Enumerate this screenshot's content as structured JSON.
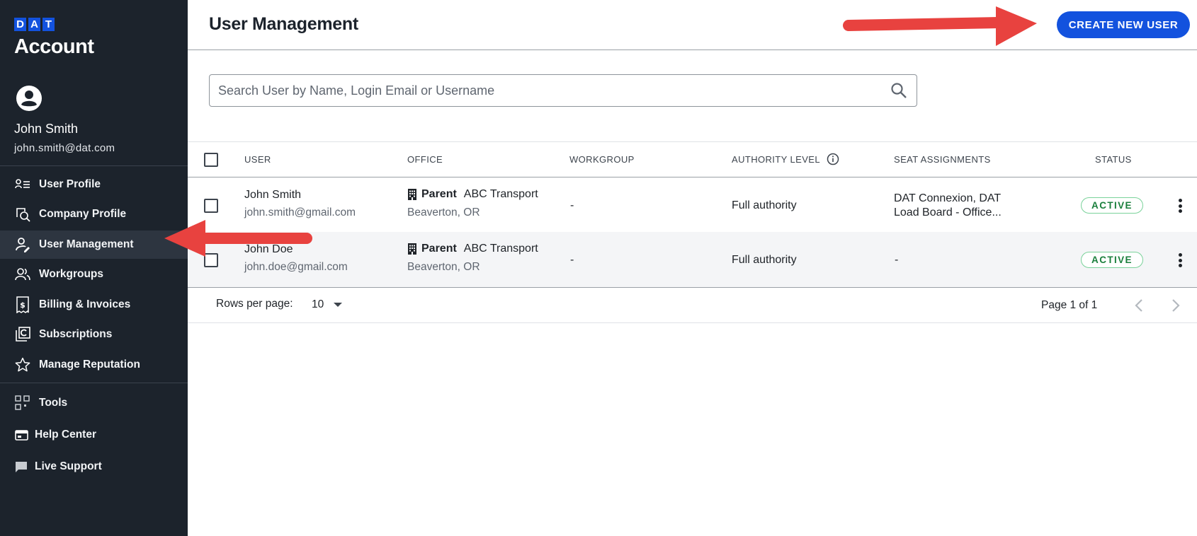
{
  "brand": {
    "letters": [
      "D",
      "A",
      "T"
    ],
    "product": "Account"
  },
  "user": {
    "name": "John Smith",
    "email": "john.smith@dat.com"
  },
  "sidebar": {
    "items": [
      {
        "label": "User Profile",
        "icon": "user-profile-icon",
        "active": false
      },
      {
        "label": "Company Profile",
        "icon": "company-search-icon",
        "active": false
      },
      {
        "label": "User Management",
        "icon": "user-edit-icon",
        "active": true
      },
      {
        "label": "Workgroups",
        "icon": "group-icon",
        "active": false
      },
      {
        "label": "Billing & Invoices",
        "icon": "receipt-dollar-icon",
        "active": false
      },
      {
        "label": "Subscriptions",
        "icon": "subscriptions-icon",
        "active": false
      },
      {
        "label": "Manage Reputation",
        "icon": "star-icon",
        "active": false
      }
    ],
    "secondary": [
      {
        "label": "Tools",
        "icon": "grid-icon"
      },
      {
        "label": "Help Center",
        "icon": "help-window-icon"
      },
      {
        "label": "Live Support",
        "icon": "chat-icon"
      }
    ]
  },
  "header": {
    "title": "User Management",
    "create_button": "CREATE NEW USER"
  },
  "search": {
    "placeholder": "Search User by Name, Login Email or Username",
    "value": ""
  },
  "table": {
    "columns": [
      "USER",
      "OFFICE",
      "WORKGROUP",
      "AUTHORITY LEVEL",
      "SEAT ASSIGNMENTS",
      "STATUS"
    ],
    "rows": [
      {
        "name": "John Smith",
        "email": "john.smith@gmail.com",
        "office_type": "Parent",
        "office_name": "ABC Transport",
        "office_location": "Beaverton, OR",
        "workgroup": "-",
        "authority": "Full authority",
        "seats_line1": "DAT Connexion, DAT",
        "seats_line2": "Load Board - Office...",
        "status": "ACTIVE"
      },
      {
        "name": "John Doe",
        "email": "john.doe@gmail.com",
        "office_type": "Parent",
        "office_name": "ABC Transport",
        "office_location": "Beaverton, OR",
        "workgroup": "-",
        "authority": "Full authority",
        "seats_line1": "-",
        "seats_line2": "",
        "status": "ACTIVE"
      }
    ]
  },
  "footer": {
    "rows_per_page_label": "Rows per page:",
    "rows_per_page_value": "10",
    "page_info": "Page 1 of 1"
  },
  "colors": {
    "sidebar_bg": "#1c232c",
    "accent": "#1352de",
    "active_status": "#1a7f3c",
    "annotation_arrow": "#e8423f"
  }
}
